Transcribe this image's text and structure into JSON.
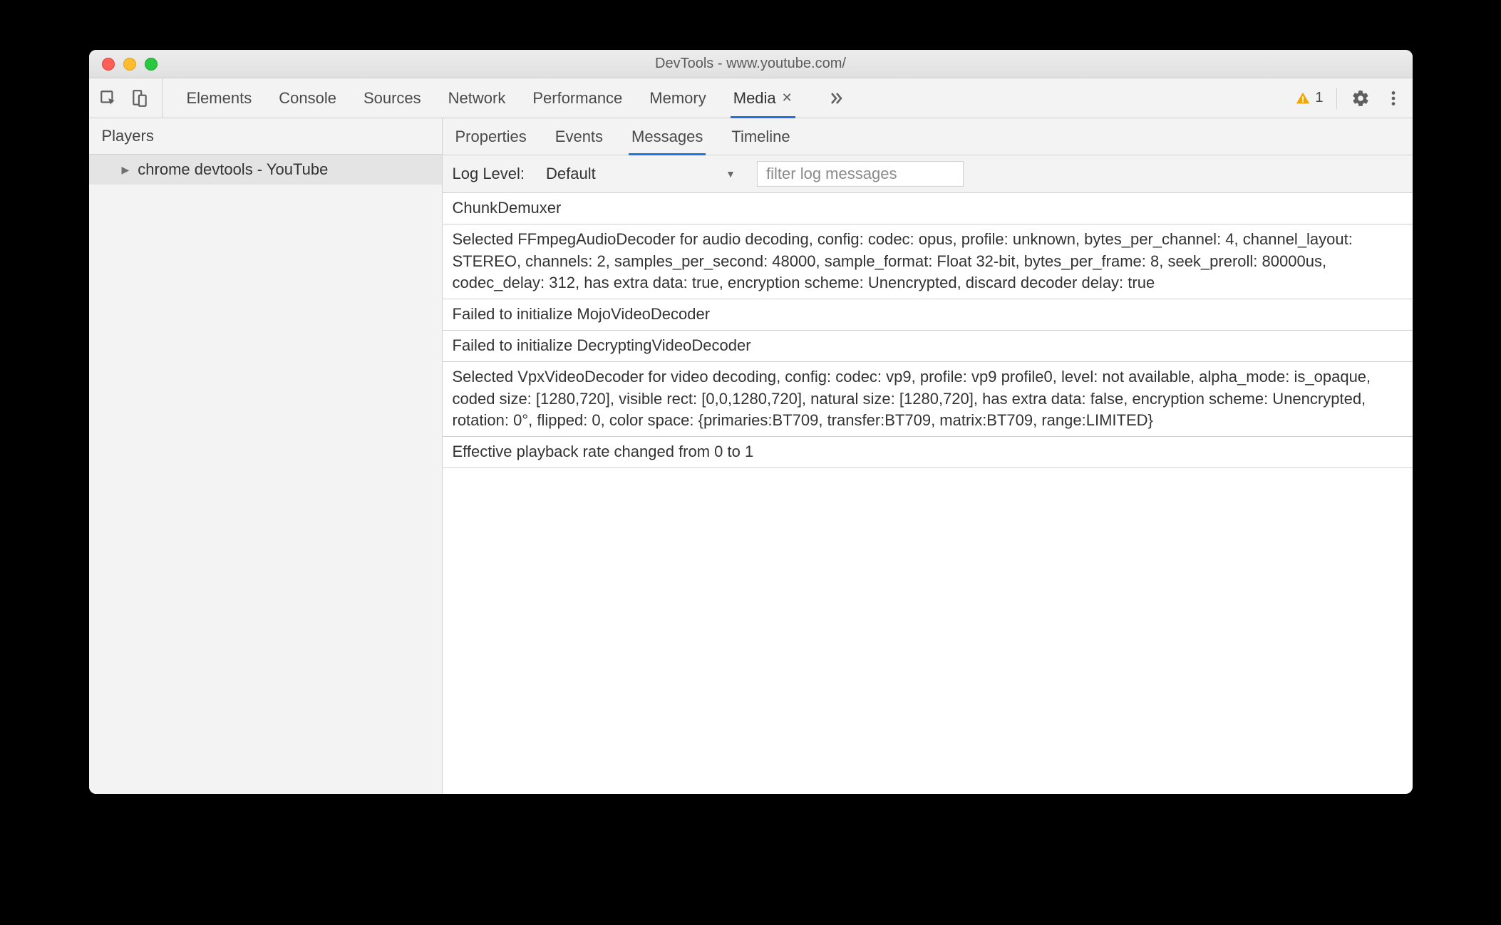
{
  "window": {
    "title": "DevTools - www.youtube.com/"
  },
  "toolbar": {
    "tabs": [
      "Elements",
      "Console",
      "Sources",
      "Network",
      "Performance",
      "Memory",
      "Media"
    ],
    "activeTab": "Media",
    "warningCount": "1"
  },
  "sidebar": {
    "header": "Players",
    "items": [
      "chrome devtools - YouTube"
    ],
    "selectedIndex": 0
  },
  "subtabs": {
    "items": [
      "Properties",
      "Events",
      "Messages",
      "Timeline"
    ],
    "active": "Messages"
  },
  "filterbar": {
    "label": "Log Level:",
    "selectValue": "Default",
    "placeholder": "filter log messages"
  },
  "messages": [
    "ChunkDemuxer",
    "Selected FFmpegAudioDecoder for audio decoding, config: codec: opus, profile: unknown, bytes_per_channel: 4, channel_layout: STEREO, channels: 2, samples_per_second: 48000, sample_format: Float 32-bit, bytes_per_frame: 8, seek_preroll: 80000us, codec_delay: 312, has extra data: true, encryption scheme: Unencrypted, discard decoder delay: true",
    "Failed to initialize MojoVideoDecoder",
    "Failed to initialize DecryptingVideoDecoder",
    "Selected VpxVideoDecoder for video decoding, config: codec: vp9, profile: vp9 profile0, level: not available, alpha_mode: is_opaque, coded size: [1280,720], visible rect: [0,0,1280,720], natural size: [1280,720], has extra data: false, encryption scheme: Unencrypted, rotation: 0°, flipped: 0, color space: {primaries:BT709, transfer:BT709, matrix:BT709, range:LIMITED}",
    "Effective playback rate changed from 0 to 1"
  ]
}
